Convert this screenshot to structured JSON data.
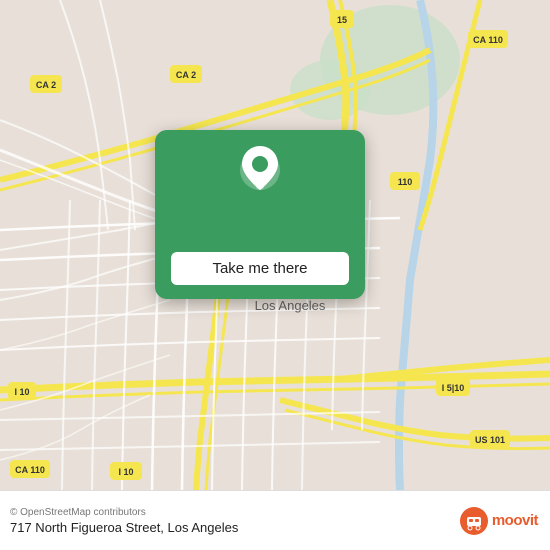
{
  "map": {
    "background_color": "#e8e0d8"
  },
  "popup": {
    "button_label": "Take me there",
    "background_color": "#3a9c5f"
  },
  "footer": {
    "copyright": "© OpenStreetMap contributors",
    "address": "717 North Figueroa Street, Los Angeles",
    "moovit_text": "moovit"
  }
}
